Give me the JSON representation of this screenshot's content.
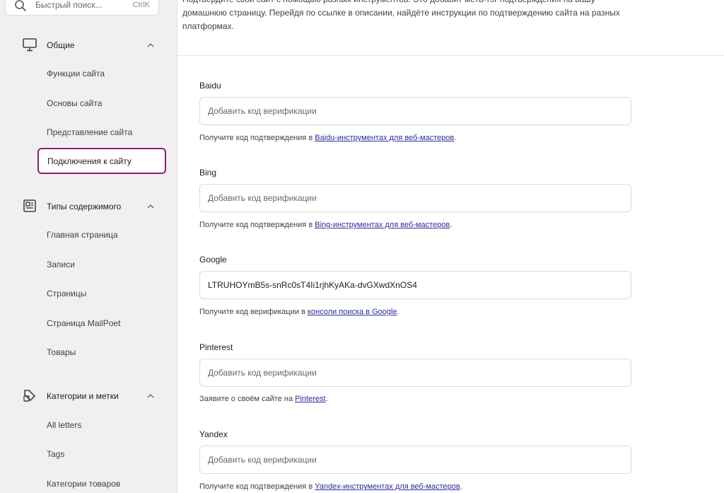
{
  "search": {
    "placeholder": "Быстрый поиск...",
    "shortcut": "CtrlK",
    "icon": "search-icon"
  },
  "sidebar": {
    "sections": [
      {
        "label": "Общие",
        "icon": "desktop-icon",
        "items": [
          "Функции сайта",
          "Основы сайта",
          "Представление сайта",
          "Подключения к сайту"
        ],
        "active": "Подключения к сайту"
      },
      {
        "label": "Типы содержимого",
        "icon": "content-types-icon",
        "items": [
          "Главная страница",
          "Записи",
          "Страницы",
          "Страница MailPoet",
          "Товары"
        ]
      },
      {
        "label": "Категории и метки",
        "icon": "taxonomy-icon",
        "items": [
          "All letters",
          "Tags",
          "Категории товаров"
        ]
      }
    ]
  },
  "main": {
    "intro": "Подтвердите свой сайт с помощью разных инструментов. Это добавит мета-тэг подтверждения на вашу домашнюю страницу. Перейдя по ссылке в описании, найдёте инструкции по подтверждению сайта на разных платформах.",
    "fields": [
      {
        "label": "Baidu",
        "value": "",
        "placeholder": "Добавить код верификации",
        "help_prefix": "Получите код подтверждения в ",
        "help_link": "Baidu-инструментах для веб-мастеров",
        "help_suffix": "."
      },
      {
        "label": "Bing",
        "value": "",
        "placeholder": "Добавить код верификации",
        "help_prefix": "Получите код подтверждения в ",
        "help_link": "Bing-инструментах для веб-мастеров",
        "help_suffix": "."
      },
      {
        "label": "Google",
        "value": "LTRUHOYmB5s-snRc0sT4Ii1rjhKyAKa-dvGXwdXnOS4",
        "placeholder": "Добавить код верификации",
        "help_prefix": "Получите код верификации в ",
        "help_link": "консоли поиска в Google",
        "help_suffix": "."
      },
      {
        "label": "Pinterest",
        "value": "",
        "placeholder": "Добавить код верификации",
        "help_prefix": "Заявите о своём сайте на ",
        "help_link": "Pinterest",
        "help_suffix": "."
      },
      {
        "label": "Yandex",
        "value": "",
        "placeholder": "Добавить код верификации",
        "help_prefix": "Получите код подтверждения в ",
        "help_link": "Yandex-инструментах для веб-мастеров",
        "help_suffix": "."
      }
    ]
  },
  "colors": {
    "active_border": "#8a1f6e",
    "link": "#2b2d99",
    "sidebar_bg": "#f0f0f1"
  }
}
